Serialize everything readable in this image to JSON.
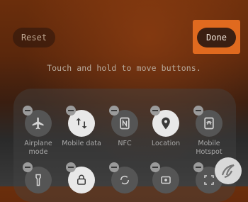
{
  "header": {
    "reset_label": "Reset",
    "done_label": "Done"
  },
  "hint": "Touch and hold to move buttons.",
  "tiles": [
    {
      "label": "Airplane mode",
      "icon": "airplane-icon",
      "active": false
    },
    {
      "label": "Mobile data",
      "icon": "mobile-data-icon",
      "active": true
    },
    {
      "label": "NFC",
      "icon": "nfc-icon",
      "active": false
    },
    {
      "label": "Location",
      "icon": "location-icon",
      "active": true
    },
    {
      "label": "Mobile Hotspot",
      "icon": "hotspot-icon",
      "active": false
    }
  ],
  "row2_icons": [
    "flashlight-icon",
    "lock-icon",
    "sync-icon",
    "screen-record-icon",
    "screenshot-icon"
  ],
  "colors": {
    "accent": "#e06a1f",
    "done_button": "#3b1f12"
  }
}
